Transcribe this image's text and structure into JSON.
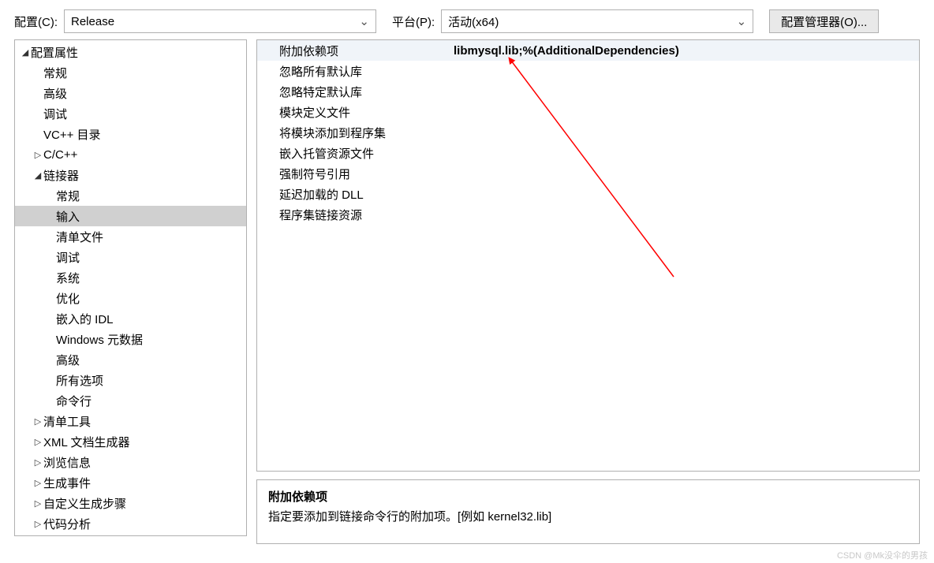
{
  "topbar": {
    "config_label": "配置(C):",
    "config_value": "Release",
    "platform_label": "平台(P):",
    "platform_value": "活动(x64)",
    "manager_button": "配置管理器(O)..."
  },
  "tree": {
    "root": "配置属性",
    "items": [
      {
        "label": "常规",
        "indent": 2,
        "toggle": ""
      },
      {
        "label": "高级",
        "indent": 2,
        "toggle": ""
      },
      {
        "label": "调试",
        "indent": 2,
        "toggle": ""
      },
      {
        "label": "VC++ 目录",
        "indent": 2,
        "toggle": ""
      },
      {
        "label": "C/C++",
        "indent": 2,
        "toggle": "▷"
      },
      {
        "label": "链接器",
        "indent": 2,
        "toggle": "◢"
      },
      {
        "label": "常规",
        "indent": 3,
        "toggle": ""
      },
      {
        "label": "输入",
        "indent": 3,
        "toggle": "",
        "selected": true
      },
      {
        "label": "清单文件",
        "indent": 3,
        "toggle": ""
      },
      {
        "label": "调试",
        "indent": 3,
        "toggle": ""
      },
      {
        "label": "系统",
        "indent": 3,
        "toggle": ""
      },
      {
        "label": "优化",
        "indent": 3,
        "toggle": ""
      },
      {
        "label": "嵌入的 IDL",
        "indent": 3,
        "toggle": ""
      },
      {
        "label": "Windows 元数据",
        "indent": 3,
        "toggle": ""
      },
      {
        "label": "高级",
        "indent": 3,
        "toggle": ""
      },
      {
        "label": "所有选项",
        "indent": 3,
        "toggle": ""
      },
      {
        "label": "命令行",
        "indent": 3,
        "toggle": ""
      },
      {
        "label": "清单工具",
        "indent": 2,
        "toggle": "▷"
      },
      {
        "label": "XML 文档生成器",
        "indent": 2,
        "toggle": "▷"
      },
      {
        "label": "浏览信息",
        "indent": 2,
        "toggle": "▷"
      },
      {
        "label": "生成事件",
        "indent": 2,
        "toggle": "▷"
      },
      {
        "label": "自定义生成步骤",
        "indent": 2,
        "toggle": "▷"
      },
      {
        "label": "代码分析",
        "indent": 2,
        "toggle": "▷"
      }
    ]
  },
  "props": [
    {
      "label": "附加依赖项",
      "value": "libmysql.lib;%(AdditionalDependencies)",
      "selected": true
    },
    {
      "label": "忽略所有默认库",
      "value": ""
    },
    {
      "label": "忽略特定默认库",
      "value": ""
    },
    {
      "label": "模块定义文件",
      "value": ""
    },
    {
      "label": "将模块添加到程序集",
      "value": ""
    },
    {
      "label": "嵌入托管资源文件",
      "value": ""
    },
    {
      "label": "强制符号引用",
      "value": ""
    },
    {
      "label": "延迟加载的 DLL",
      "value": ""
    },
    {
      "label": "程序集链接资源",
      "value": ""
    }
  ],
  "desc": {
    "title": "附加依赖项",
    "text": "指定要添加到链接命令行的附加项。[例如 kernel32.lib]"
  },
  "watermark": "CSDN @Mk没伞的男孩"
}
